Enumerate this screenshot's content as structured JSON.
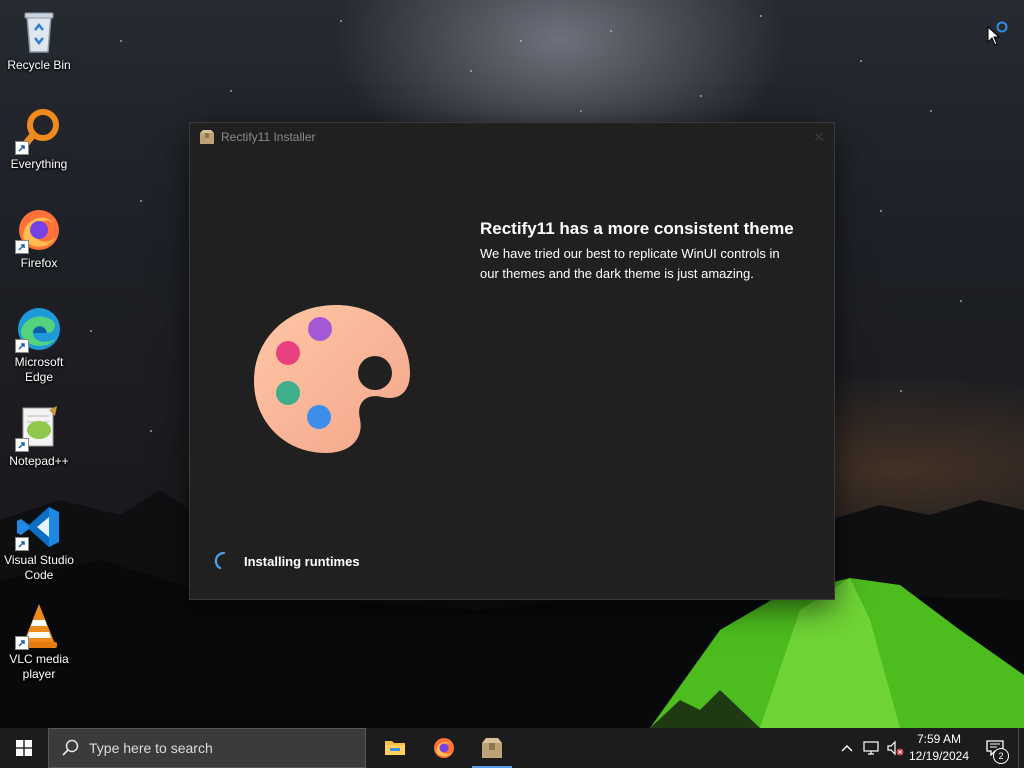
{
  "desktop_icons": [
    {
      "label": "Recycle Bin",
      "icon": "recycle-bin-icon"
    },
    {
      "label": "Everything",
      "icon": "everything-search-icon"
    },
    {
      "label": "Firefox",
      "icon": "firefox-icon"
    },
    {
      "label": "Microsoft Edge",
      "icon": "edge-icon"
    },
    {
      "label": "Notepad++",
      "icon": "notepadpp-icon"
    },
    {
      "label": "Visual Studio Code",
      "icon": "vscode-icon"
    },
    {
      "label": "VLC media player",
      "icon": "vlc-icon"
    }
  ],
  "installer": {
    "title": "Rectify11 Installer",
    "close_glyph": "✕",
    "headline": "Rectify11 has a more consistent theme",
    "description": "We have tried our best to replicate WinUI controls in our themes and the dark theme is just amazing.",
    "status": "Installing runtimes",
    "illustration": "palette-icon"
  },
  "taskbar": {
    "search_placeholder": "Type here to search",
    "pinned": [
      {
        "name": "File Explorer",
        "icon": "file-explorer-icon"
      },
      {
        "name": "Firefox",
        "icon": "firefox-icon"
      },
      {
        "name": "Rectify11 Installer",
        "icon": "installer-icon",
        "active": true
      }
    ],
    "tray": {
      "time": "7:59 AM",
      "date": "12/19/2024",
      "notification_count": "2"
    }
  },
  "colors": {
    "window_bg": "#202020",
    "accent": "#5aa0e6",
    "taskbar_bg": "#1c1c1c"
  }
}
